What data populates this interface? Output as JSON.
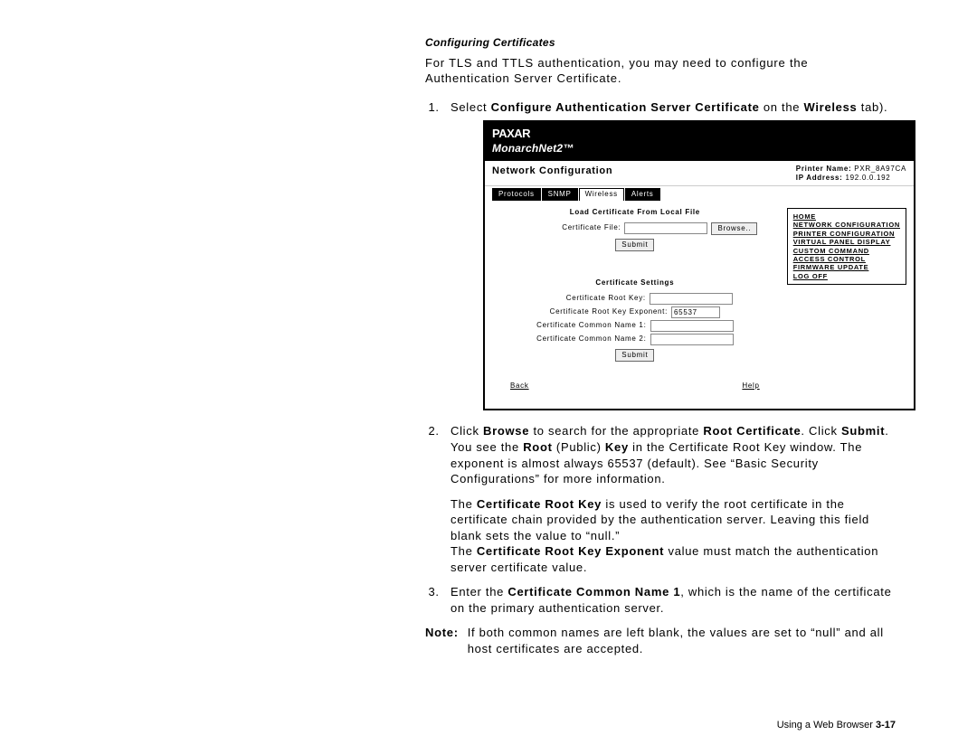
{
  "section_title": "Configuring Certificates",
  "intro": "For TLS and TTLS authentication, you may need to configure the Authentication Server Certificate.",
  "step1_pre": "Select ",
  "step1_b1": "Configure Authentication Server Certificate",
  "step1_mid": " on the ",
  "step1_b2": "Wireless",
  "step1_post": " tab).",
  "shot": {
    "brand1": "PAXAR",
    "brand2": "MonarchNet2™",
    "nc": "Network Configuration",
    "pn_lbl": "Printer Name:",
    "pn_val": "PXR_8A97CA",
    "ip_lbl": "IP Address:",
    "ip_val": "192.0.0.192",
    "tabs": [
      "Protocols",
      "SNMP",
      "Wireless",
      "Alerts"
    ],
    "form1_title": "Load Certificate From Local File",
    "cert_file_lbl": "Certificate File:",
    "browse": "Browse..",
    "submit": "Submit",
    "form2_title": "Certificate Settings",
    "root_key_lbl": "Certificate Root Key:",
    "root_exp_lbl": "Certificate Root Key Exponent:",
    "root_exp_val": "65537",
    "cn1_lbl": "Certificate Common Name 1:",
    "cn2_lbl": "Certificate Common Name 2:",
    "nav": [
      "HOME",
      "NETWORK CONFIGURATION",
      "PRINTER CONFIGURATION",
      "VIRTUAL PANEL DISPLAY",
      "CUSTOM COMMAND",
      "ACCESS CONTROL",
      "FIRMWARE UPDATE",
      "LOG OFF"
    ],
    "back": "Back",
    "help": "Help"
  },
  "step2_a": "Click ",
  "step2_b_browse": "Browse",
  "step2_b": " to search for the appropriate ",
  "step2_b_root": "Root Certificate",
  "step2_c": ".  Click ",
  "step2_b_submit": "Submit",
  "step2_d": ".  You see the ",
  "step2_b_rootpk1": "Root",
  "step2_e": " (Public) ",
  "step2_b_rootpk2": "Key",
  "step2_f": " in the Certificate Root Key window.  The exponent is almost always 65537 (default).  See “Basic Security Configurations” for more information.",
  "para_crk_a": "The ",
  "para_crk_b": "Certificate Root Key",
  "para_crk_c": " is used to verify the root certificate in the certificate chain provided by the authentication server.  Leaving this field blank sets the value to “null.”",
  "para_exp_a": "The ",
  "para_exp_b": "Certificate Root Key Exponent",
  "para_exp_c": " value must match the authentication server certificate value.",
  "step3_a": "Enter the ",
  "step3_b": "Certificate Common Name 1",
  "step3_c": ", which is the name of the certificate on the primary authentication server.",
  "note_lbl": "Note:",
  "note_txt": "If both common names are left blank, the values are set to “null” and all host certificates are accepted.",
  "footer_a": "Using a Web Browser  ",
  "footer_b": "3-17"
}
